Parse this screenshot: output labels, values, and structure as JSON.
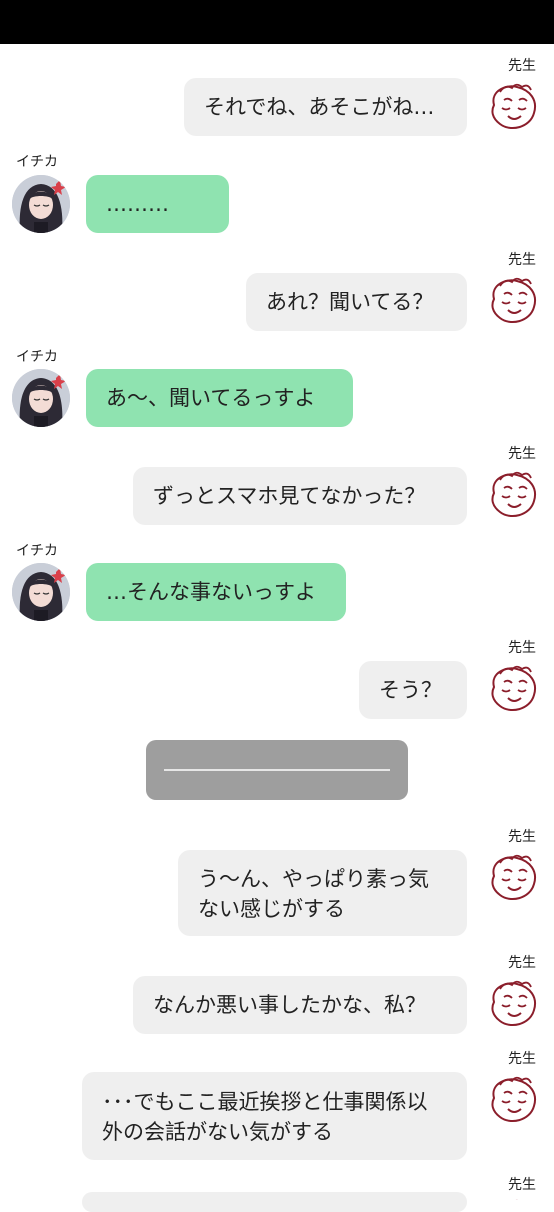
{
  "status_bar": {},
  "sensei_name": "先生",
  "ichika_name": "イチカ",
  "messages": [
    {
      "speaker": "sensei",
      "text": "それでね、あそこがね…"
    },
    {
      "speaker": "ichika",
      "text": "………"
    },
    {
      "speaker": "sensei",
      "text": "あれ？聞いてる？"
    },
    {
      "speaker": "ichika",
      "text": "あ〜、聞いてるっすよ"
    },
    {
      "speaker": "sensei",
      "text": "ずっとスマホ見てなかった？"
    },
    {
      "speaker": "ichika",
      "text": "…そんな事ないっすよ"
    },
    {
      "speaker": "sensei",
      "text": "そう？"
    },
    {
      "speaker": "sensei",
      "text": "う〜ん、やっぱり素っ気ない感じがする"
    },
    {
      "speaker": "sensei",
      "text": "なんか悪い事したかな、私？"
    },
    {
      "speaker": "sensei",
      "text": "･･･でもここ最近挨拶と仕事関係以外の会話がない気がする"
    }
  ],
  "colors": {
    "sensei_bubble": "#efefef",
    "ichika_bubble": "#8fe3b0",
    "divider_box": "#9e9e9e",
    "sensei_avatar_stroke": "#8b1e2b"
  },
  "icons": {
    "sensei_avatar": "smiley-doodle-icon",
    "ichika_avatar": "character-portrait-icon"
  }
}
